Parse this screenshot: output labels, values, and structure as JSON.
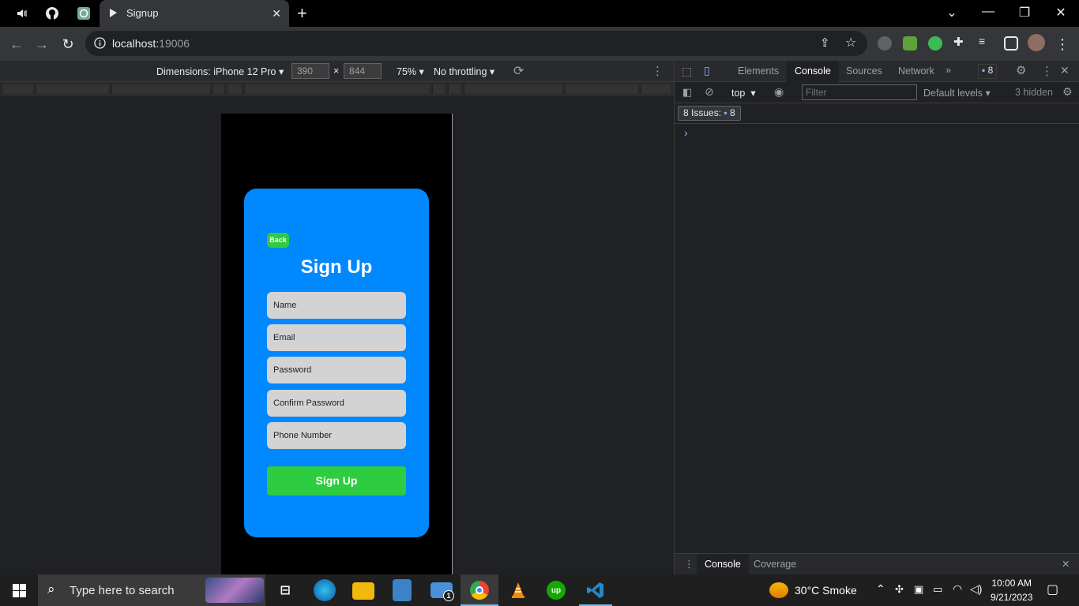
{
  "browser": {
    "tab_title": "Signup",
    "url_host": "localhost:",
    "url_port": "19006"
  },
  "device_toolbar": {
    "dimensions_label": "Dimensions: iPhone 12 Pro",
    "width": "390",
    "height": "844",
    "times": "×",
    "zoom": "75%",
    "throttling": "No throttling"
  },
  "signup": {
    "back_label": "Back",
    "title": "Sign Up",
    "fields": {
      "name_placeholder": "Name",
      "email_placeholder": "Email",
      "password_placeholder": "Password",
      "confirm_placeholder": "Confirm Password",
      "phone_placeholder": "Phone Number"
    },
    "submit_label": "Sign Up"
  },
  "devtools": {
    "tabs": {
      "elements": "Elements",
      "console": "Console",
      "sources": "Sources",
      "network": "Network"
    },
    "issue_count": "8",
    "context": "top",
    "filter_placeholder": "Filter",
    "levels": "Default levels",
    "hidden": "3 hidden",
    "issues_label": "8 Issues:",
    "issues_count": "8",
    "prompt": "›",
    "drawer": {
      "console": "Console",
      "coverage": "Coverage"
    }
  },
  "taskbar": {
    "search_placeholder": "Type here to search",
    "weather": "30°C  Smoke",
    "mail_badge": "1",
    "time": "10:00 AM",
    "date": "9/21/2023"
  },
  "colors": {
    "card": "#0088ff",
    "green": "#2ecc40",
    "field": "#d3d3d3"
  }
}
